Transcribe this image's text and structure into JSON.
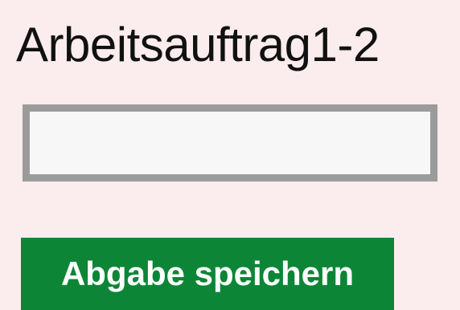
{
  "page": {
    "title": "Arbeitsauftrag1-2"
  },
  "answer": {
    "value": "",
    "placeholder": ""
  },
  "actions": {
    "save_label": "Abgabe speichern"
  },
  "colors": {
    "background": "#fbeced",
    "input_border": "#9b9b9b",
    "input_background": "#f7f7f7",
    "button_background": "#0c8636",
    "button_text": "#ffffff"
  }
}
